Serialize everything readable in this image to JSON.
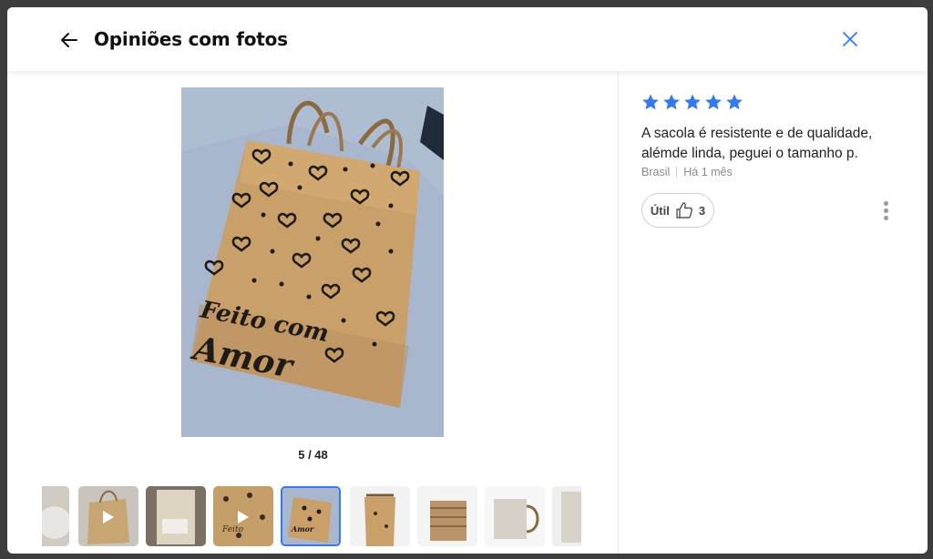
{
  "header": {
    "title": "Opiniões com fotos"
  },
  "gallery": {
    "counter": "5 / 48"
  },
  "photo": {
    "text_line1": "Feito com",
    "text_line2": "Amor"
  },
  "review": {
    "rating": 5,
    "text": "A sacola é resistente e de qualidade, alémde linda, peguei o tamanho p.",
    "country": "Brasil",
    "date": "Há 1 mês",
    "helpful_label": "Útil",
    "helpful_count": "3"
  },
  "colors": {
    "accent": "#3479f0",
    "star": "#3479f0",
    "bag": "#c9a06a",
    "background_fabric": "#a9b8cf"
  },
  "icons": [
    "arrow-left-icon",
    "close-icon",
    "star-icon",
    "thumbs-up-icon",
    "more-vertical-icon",
    "play-icon"
  ]
}
